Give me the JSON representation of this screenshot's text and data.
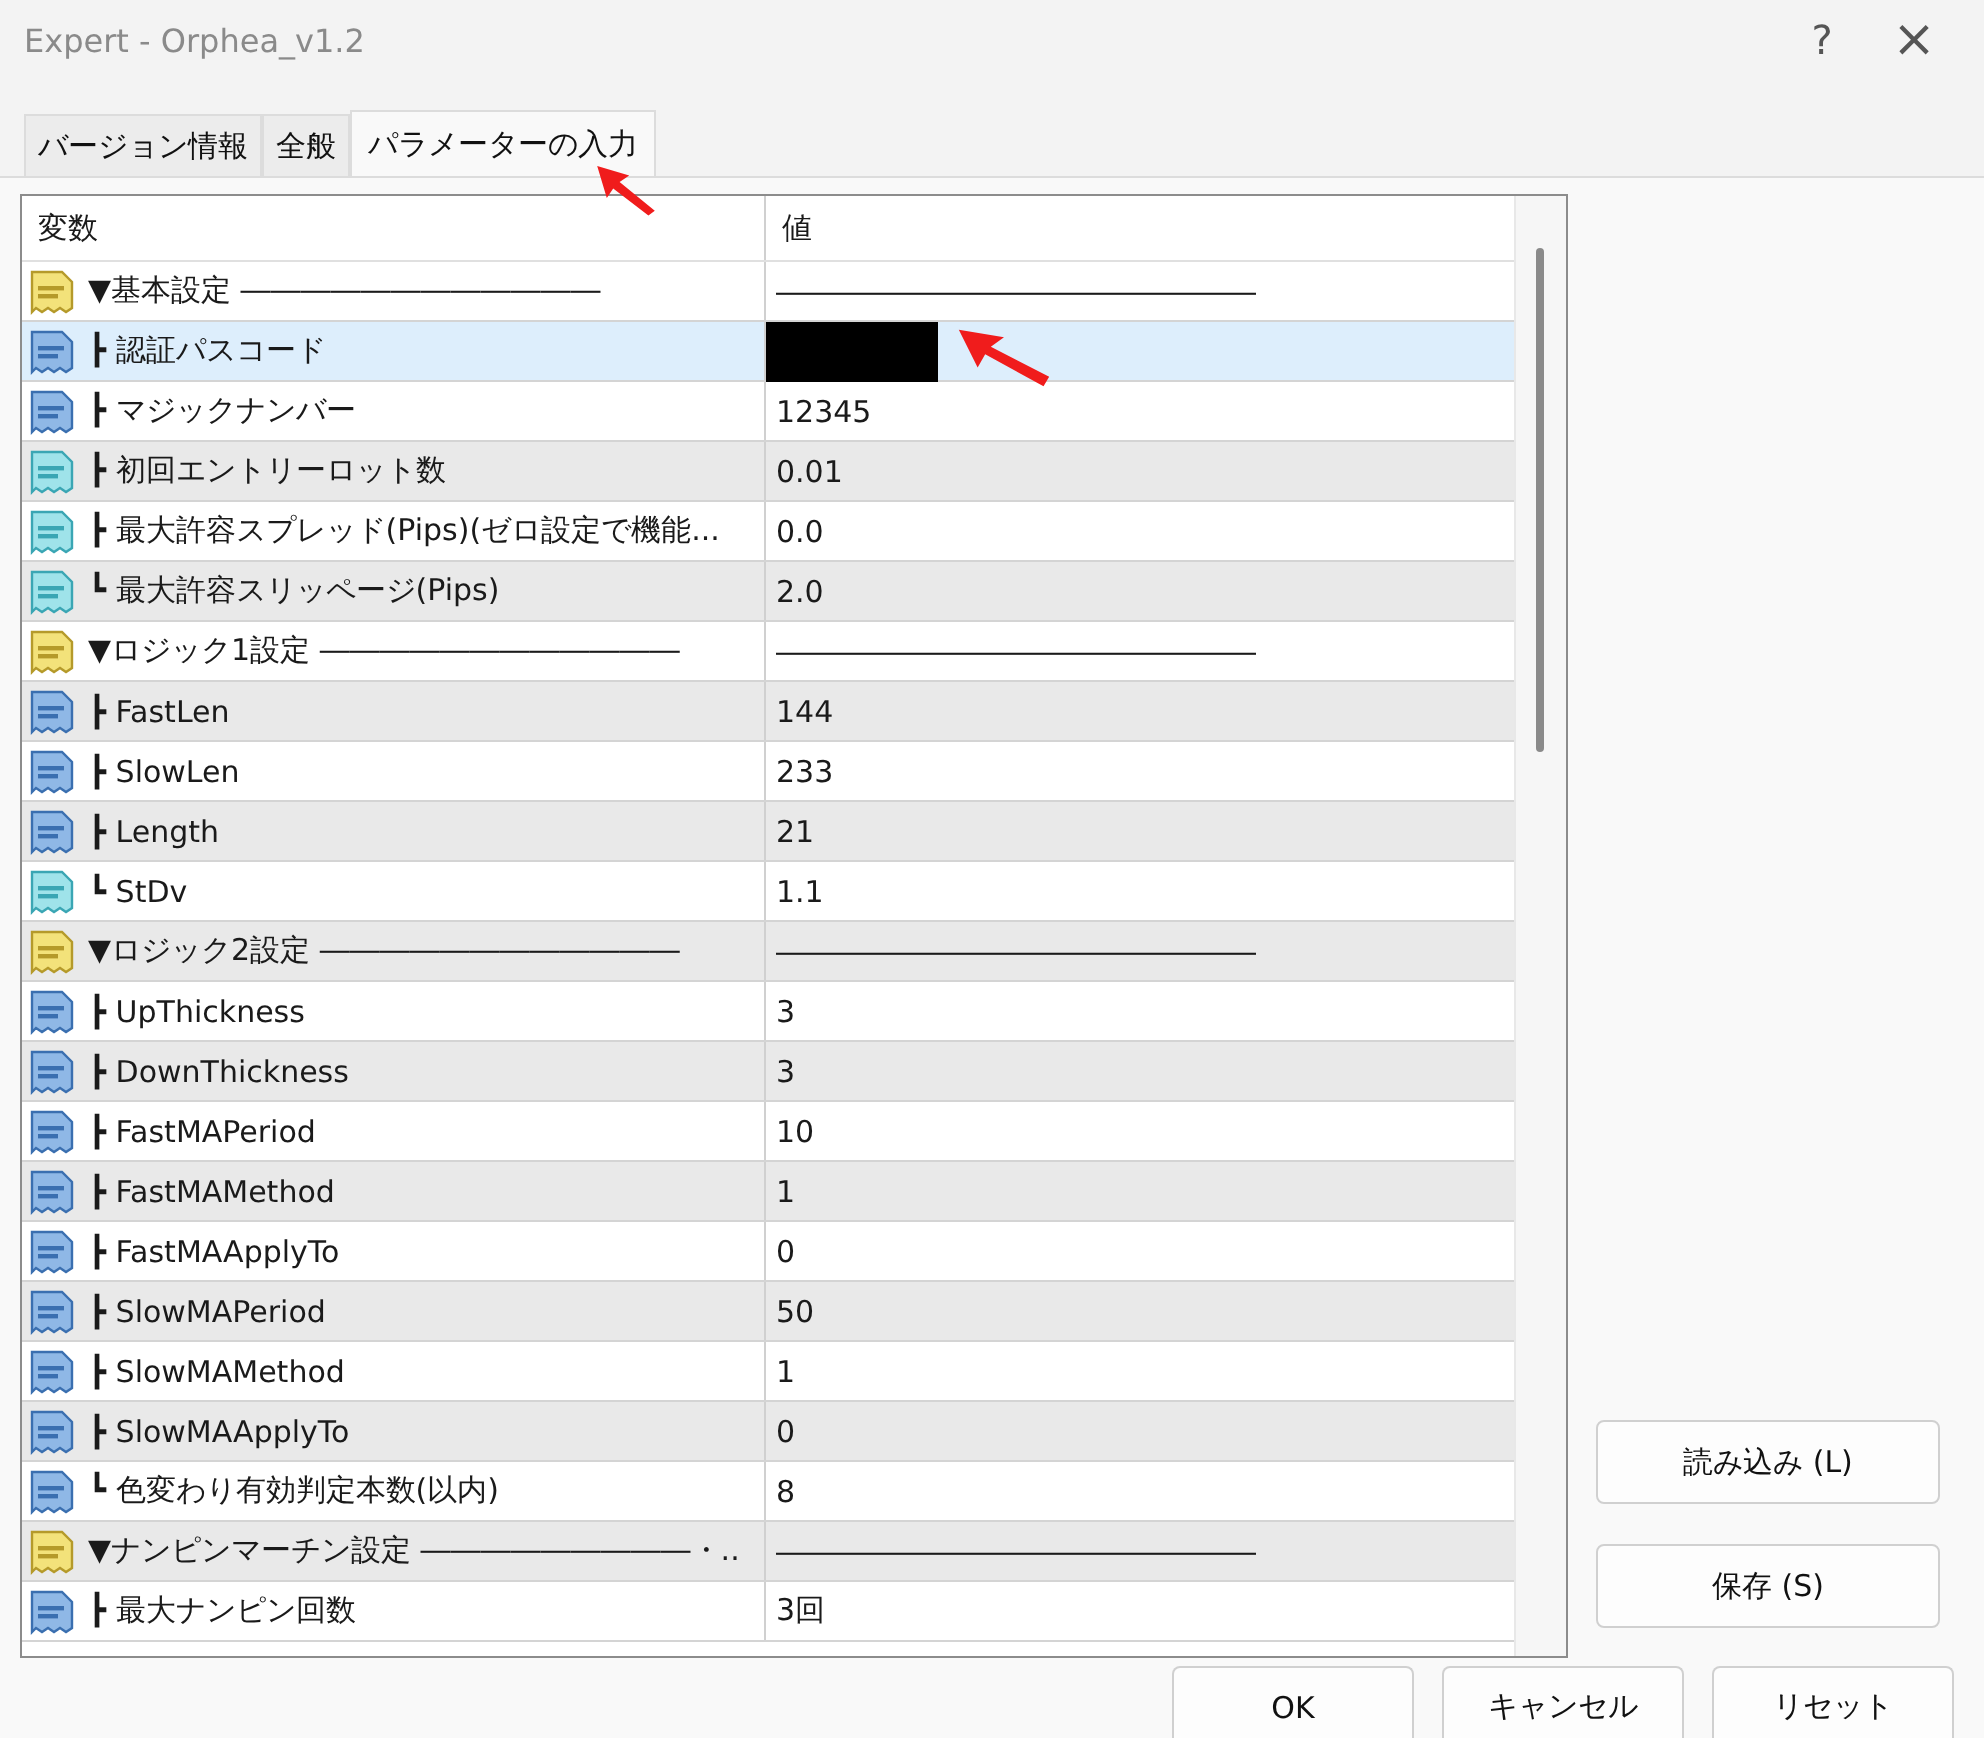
{
  "window": {
    "title": "Expert - Orphea_v1.2",
    "help": "?",
    "close": "×"
  },
  "tabs": [
    {
      "label": "バージョン情報",
      "selected": false,
      "arrow": false
    },
    {
      "label": "全般",
      "selected": false,
      "arrow": false
    },
    {
      "label": "パラメーターの入力",
      "selected": true,
      "arrow": true
    }
  ],
  "table": {
    "columns": [
      "変数",
      "値"
    ],
    "rows": [
      {
        "kind": "string",
        "name": "▼基本設定 ――――――――――――",
        "value": "――――――――――――――――",
        "selected": false,
        "redacted": false,
        "arrow": false
      },
      {
        "kind": "int",
        "name": "┣ 認証パスコード",
        "selected": true,
        "redacted": true,
        "arrow": true
      },
      {
        "kind": "int",
        "name": "┣ マジックナンバー",
        "value": "12345",
        "selected": false,
        "redacted": false,
        "arrow": false
      },
      {
        "kind": "double",
        "name": "┣ 初回エントリーロット数",
        "value": "0.01",
        "selected": false,
        "redacted": false,
        "arrow": false
      },
      {
        "kind": "double",
        "name": "┣ 最大許容スプレッド(Pips)(ゼロ設定で機能...",
        "value": "0.0",
        "selected": false,
        "redacted": false,
        "arrow": false
      },
      {
        "kind": "double",
        "name": "┗ 最大許容スリッページ(Pips)",
        "value": "2.0",
        "selected": false,
        "redacted": false,
        "arrow": false
      },
      {
        "kind": "string",
        "name": "▼ロジック1設定 ――――――――――――",
        "value": "――――――――――――――――",
        "selected": false,
        "redacted": false,
        "arrow": false
      },
      {
        "kind": "int",
        "name": "┣ FastLen",
        "value": "144",
        "selected": false,
        "redacted": false,
        "arrow": false
      },
      {
        "kind": "int",
        "name": "┣ SlowLen",
        "value": "233",
        "selected": false,
        "redacted": false,
        "arrow": false
      },
      {
        "kind": "int",
        "name": "┣ Length",
        "value": "21",
        "selected": false,
        "redacted": false,
        "arrow": false
      },
      {
        "kind": "double",
        "name": "┗ StDv",
        "value": "1.1",
        "selected": false,
        "redacted": false,
        "arrow": false
      },
      {
        "kind": "string",
        "name": "▼ロジック2設定 ――――――――――――",
        "value": "――――――――――――――――",
        "selected": false,
        "redacted": false,
        "arrow": false
      },
      {
        "kind": "int",
        "name": "┣ UpThickness",
        "value": "3",
        "selected": false,
        "redacted": false,
        "arrow": false
      },
      {
        "kind": "int",
        "name": "┣ DownThickness",
        "value": "3",
        "selected": false,
        "redacted": false,
        "arrow": false
      },
      {
        "kind": "int",
        "name": "┣ FastMAPeriod",
        "value": "10",
        "selected": false,
        "redacted": false,
        "arrow": false
      },
      {
        "kind": "int",
        "name": "┣ FastMAMethod",
        "value": "1",
        "selected": false,
        "redacted": false,
        "arrow": false
      },
      {
        "kind": "int",
        "name": "┣ FastMAApplyTo",
        "value": "0",
        "selected": false,
        "redacted": false,
        "arrow": false
      },
      {
        "kind": "int",
        "name": "┣ SlowMAPeriod",
        "value": "50",
        "selected": false,
        "redacted": false,
        "arrow": false
      },
      {
        "kind": "int",
        "name": "┣ SlowMAMethod",
        "value": "1",
        "selected": false,
        "redacted": false,
        "arrow": false
      },
      {
        "kind": "int",
        "name": "┣ SlowMAApplyTo",
        "value": "0",
        "selected": false,
        "redacted": false,
        "arrow": false
      },
      {
        "kind": "int",
        "name": "┗ 色変わり有効判定本数(以内)",
        "value": "8",
        "selected": false,
        "redacted": false,
        "arrow": false
      },
      {
        "kind": "string",
        "name": "▼ナンピンマーチン設定 ―――――――――・..",
        "value": "――――――――――――――――",
        "selected": false,
        "redacted": false,
        "arrow": false
      },
      {
        "kind": "int",
        "name": "┣ 最大ナンピン回数",
        "value": "3回",
        "selected": false,
        "redacted": false,
        "arrow": false
      }
    ]
  },
  "side_buttons": [
    "読み込み (L)",
    "保存 (S)"
  ],
  "buttons": [
    "OK",
    "キャンセル",
    "リセット"
  ]
}
